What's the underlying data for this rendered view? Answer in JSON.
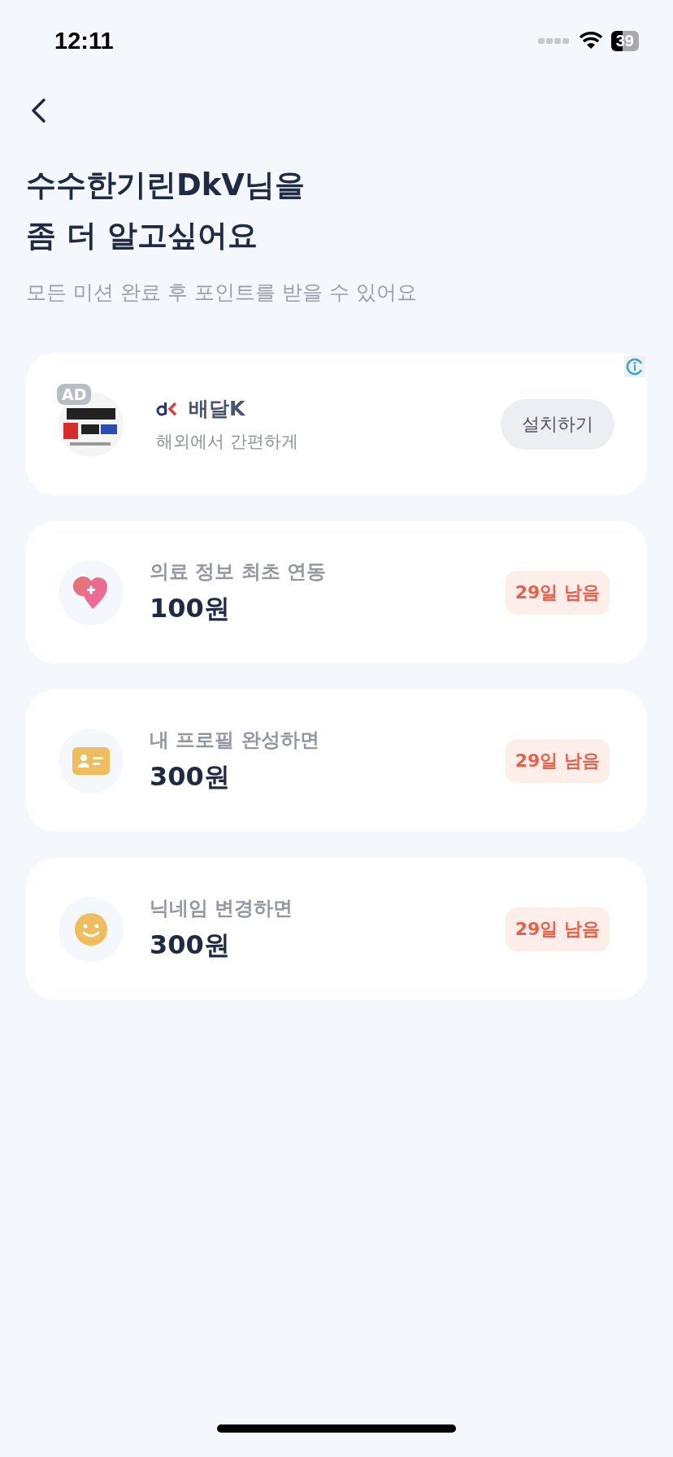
{
  "status_bar": {
    "time": "12:11",
    "battery": "39"
  },
  "header": {
    "title_lines": [
      "수수한기린DkV님을",
      "좀 더 알고싶어요"
    ],
    "subtitle": "모든 미션 완료 후 포인트를 받을 수 있어요"
  },
  "ad": {
    "badge": "AD",
    "app_name": "배달K",
    "description": "해외에서 간편하게",
    "button": "설치하기"
  },
  "missions": [
    {
      "kind": "heart",
      "title": "의료 정보 최초 연동",
      "reward": "100원",
      "remaining": "29일 남음"
    },
    {
      "kind": "card",
      "title": "내 프로필 완성하면",
      "reward": "300원",
      "remaining": "29일 남음"
    },
    {
      "kind": "smile",
      "title": "닉네임 변경하면",
      "reward": "300원",
      "remaining": "29일 남음"
    }
  ]
}
